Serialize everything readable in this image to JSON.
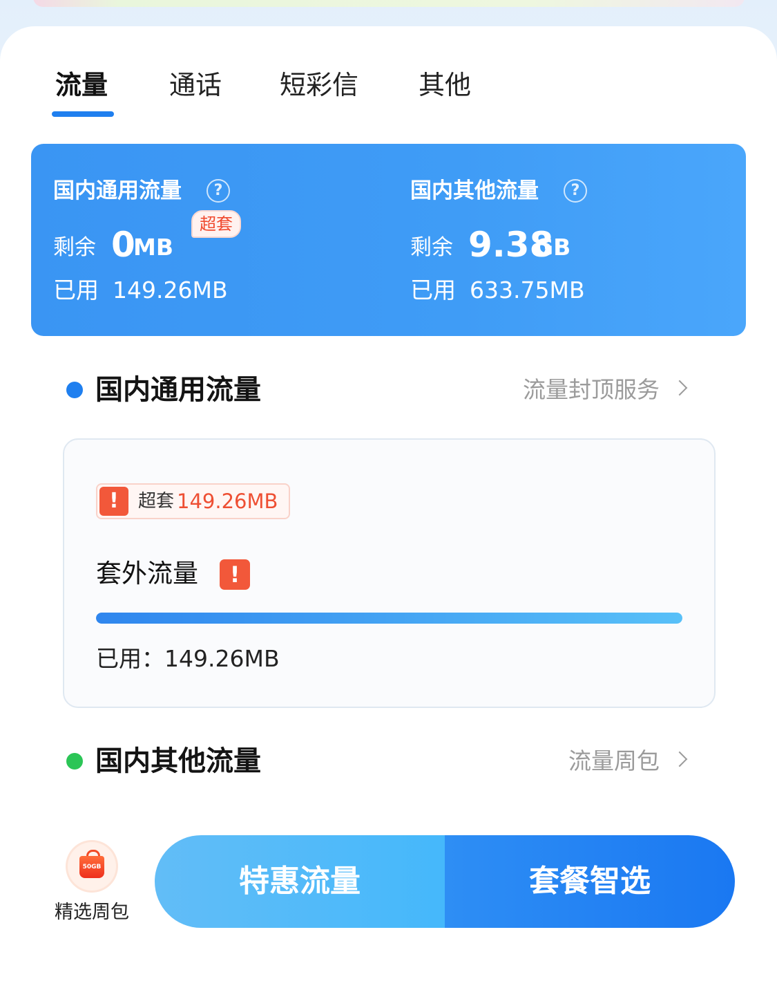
{
  "tabs": [
    {
      "label": "流量",
      "active": true
    },
    {
      "label": "通话",
      "active": false
    },
    {
      "label": "短彩信",
      "active": false
    },
    {
      "label": "其他",
      "active": false
    }
  ],
  "summary": {
    "general": {
      "title": "国内通用流量",
      "remain_label": "剩余",
      "remain_value": "0",
      "remain_unit": "MB",
      "over_badge": "超套",
      "used_label": "已用",
      "used_value": "149.26MB"
    },
    "other": {
      "title": "国内其他流量",
      "remain_label": "剩余",
      "remain_value": "9.38",
      "remain_unit": "GB",
      "used_label": "已用",
      "used_value": "633.75MB"
    },
    "help_glyph": "?"
  },
  "section_general": {
    "title": "国内通用流量",
    "link": "流量封顶服务",
    "dot_color": "#1f7fef"
  },
  "detail": {
    "overflow_tag_label": "超套",
    "overflow_tag_value": "149.26MB",
    "warn_glyph": "!",
    "extra_title": "套外流量",
    "progress_percent": 100,
    "used_text": "已用：149.26MB"
  },
  "section_other": {
    "title": "国内其他流量",
    "link": "流量周包",
    "dot_color": "#2bc556"
  },
  "bottom": {
    "weekly_pack_label": "精选周包",
    "weekly_pack_icon_text": "50GB",
    "cta_left": "特惠流量",
    "cta_right": "套餐智选"
  },
  "colors": {
    "accent_blue": "#1f7fef",
    "warning_red": "#f2583a",
    "green": "#2bc556"
  }
}
